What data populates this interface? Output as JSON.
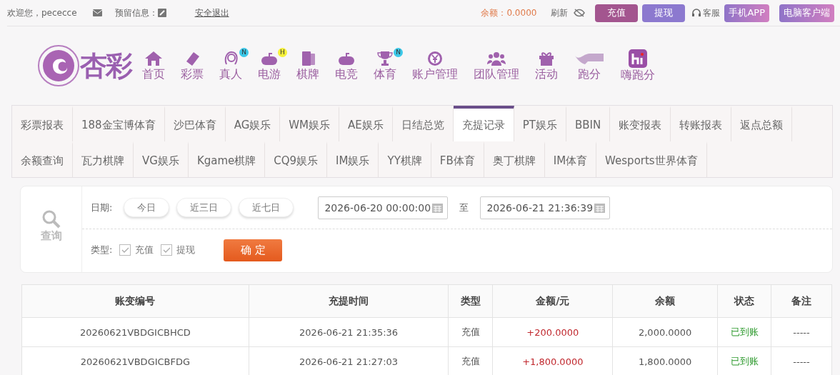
{
  "topbar": {
    "welcome": "欢迎您，pececce",
    "reserved_label": "预留信息：",
    "logout": "安全退出",
    "balance": "余额：0.0000",
    "refresh": "刷新",
    "buttons": [
      {
        "label": "充值",
        "kind": "deposit"
      },
      {
        "label": "提现",
        "kind": "withdraw"
      }
    ],
    "service": "客服",
    "app_buttons": [
      "手机APP",
      "电脑客户端"
    ]
  },
  "logo_text": "杏彩",
  "nav": [
    {
      "label": "首页"
    },
    {
      "label": "彩票"
    },
    {
      "label": "真人",
      "badge": {
        "text": "N",
        "color": "#3cc8e8"
      }
    },
    {
      "label": "电游",
      "badge": {
        "text": "H",
        "color": "#f5f03a"
      }
    },
    {
      "label": "棋牌"
    },
    {
      "label": "电竞"
    },
    {
      "label": "体育",
      "badge": {
        "text": "N",
        "color": "#3cc8e8"
      }
    },
    {
      "label": "账户管理"
    },
    {
      "label": "团队管理"
    },
    {
      "label": "活动"
    },
    {
      "label": "跑分"
    },
    {
      "label": "嗨跑分"
    }
  ],
  "tab_rows": [
    [
      {
        "label": "彩票报表",
        "selected": false
      },
      {
        "label": "188金宝博体育",
        "selected": false
      },
      {
        "label": "沙巴体育",
        "selected": false
      },
      {
        "label": "AG娱乐",
        "selected": false
      },
      {
        "label": "WM娱乐",
        "selected": false
      },
      {
        "label": "AE娱乐",
        "selected": false
      },
      {
        "label": "日结总览",
        "selected": false
      },
      {
        "label": "充提记录",
        "selected": true
      },
      {
        "label": "PT娱乐",
        "selected": false
      },
      {
        "label": "BBIN",
        "selected": false
      },
      {
        "label": "账变报表",
        "selected": false
      },
      {
        "label": "转账报表",
        "selected": false
      },
      {
        "label": "返点总额",
        "selected": false
      }
    ],
    [
      {
        "label": "余额查询",
        "selected": false
      },
      {
        "label": "瓦力棋牌",
        "selected": false
      },
      {
        "label": "VG娱乐",
        "selected": false
      },
      {
        "label": "Kgame棋牌",
        "selected": false
      },
      {
        "label": "CQ9娱乐",
        "selected": false
      },
      {
        "label": "IM娱乐",
        "selected": false
      },
      {
        "label": "YY棋牌",
        "selected": false
      },
      {
        "label": "FB体育",
        "selected": false
      },
      {
        "label": "奥丁棋牌",
        "selected": false
      },
      {
        "label": "IM体育",
        "selected": false
      },
      {
        "label": "Wesports世界体育",
        "selected": false
      }
    ]
  ],
  "filter": {
    "query_label": "查询",
    "date_label": "日期:",
    "quick_ranges": [
      "今日",
      "近三日",
      "近七日"
    ],
    "date_from": "2026-06-20 00:00:00",
    "to_label": "至",
    "date_to": "2026-06-21 21:36:39",
    "type_label": "类型:",
    "types": [
      {
        "label": "充值",
        "checked": true
      },
      {
        "label": "提现",
        "checked": true
      }
    ],
    "submit": "确 定"
  },
  "table": {
    "columns": [
      "账变编号",
      "充提时间",
      "类型",
      "金额/元",
      "余额",
      "状态",
      "备注"
    ],
    "rows": [
      [
        "20260621VBDGICBHCD",
        "2026-06-21 21:35:36",
        "充值",
        "+200.0000",
        "2,000.0000",
        "已到账",
        "-----"
      ],
      [
        "20260621VBDGICBFDG",
        "2026-06-21 21:27:03",
        "充值",
        "+1,800.0000",
        "1,800.0000",
        "已到账",
        "-----"
      ]
    ]
  }
}
